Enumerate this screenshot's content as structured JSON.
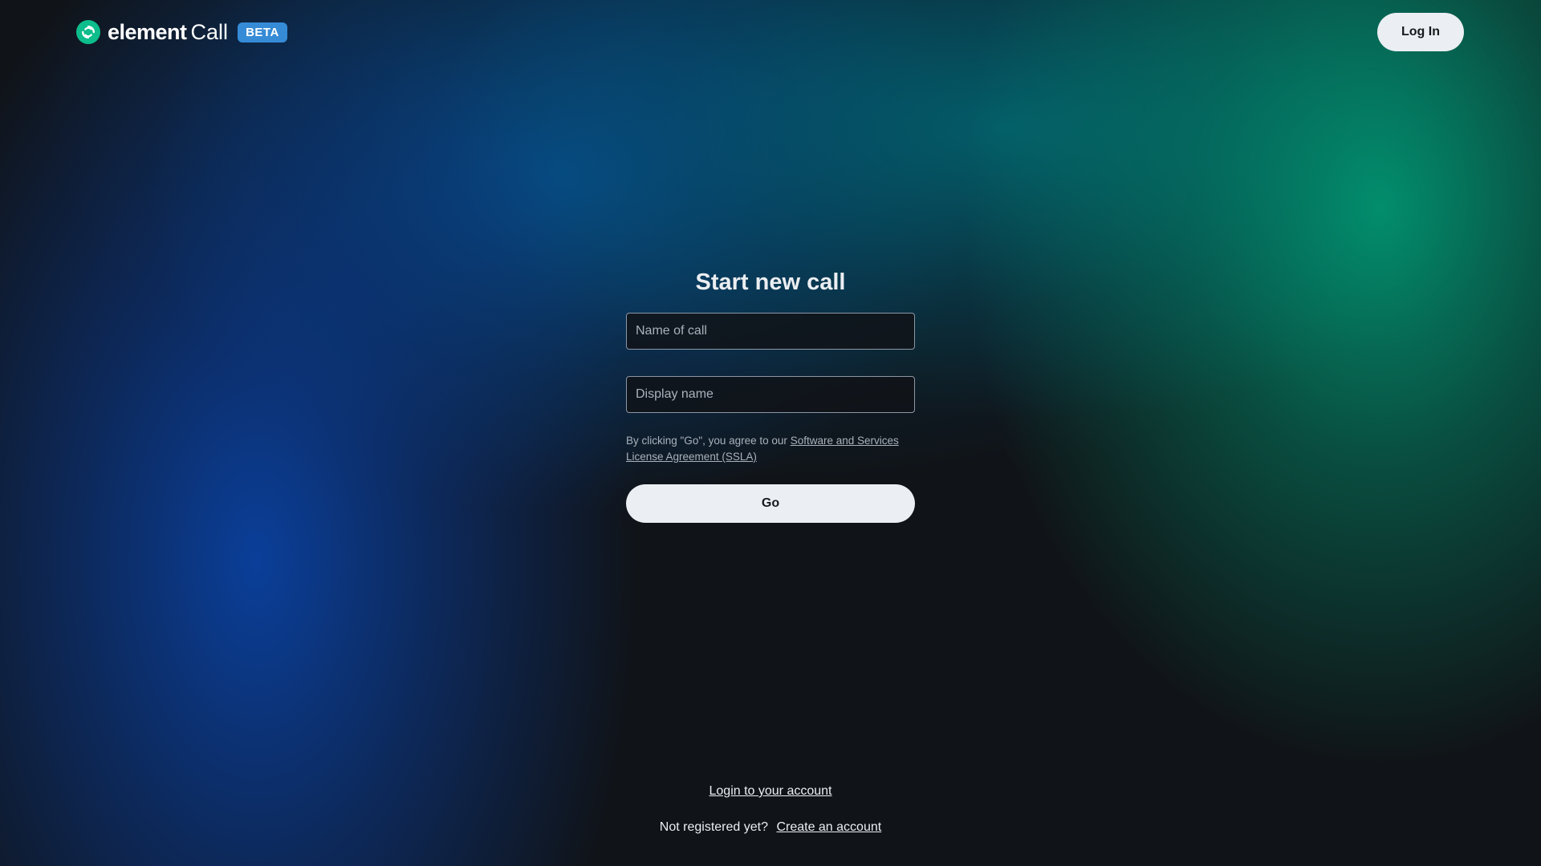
{
  "header": {
    "logo_icon": "element-logo-icon",
    "logo_word": "element",
    "logo_product": "Call",
    "beta_badge": "BETA",
    "login_button": "Log In"
  },
  "form": {
    "title": "Start new call",
    "call_name_placeholder": "Name of call",
    "call_name_value": "",
    "display_name_placeholder": "Display name",
    "display_name_value": "",
    "terms_prefix": "By clicking \"Go\", you agree to our ",
    "terms_link": "Software and Services License Agreement (SSLA)",
    "go_button": "Go"
  },
  "footer": {
    "login_link": "Login to your account",
    "not_registered": "Not registered yet?",
    "create_account_link": "Create an account"
  },
  "colors": {
    "background": "#101317",
    "accent_green": "#0dbd8b",
    "beta_blue": "#368bd6",
    "button_bg": "#ebeef2",
    "button_text": "#17191c"
  }
}
